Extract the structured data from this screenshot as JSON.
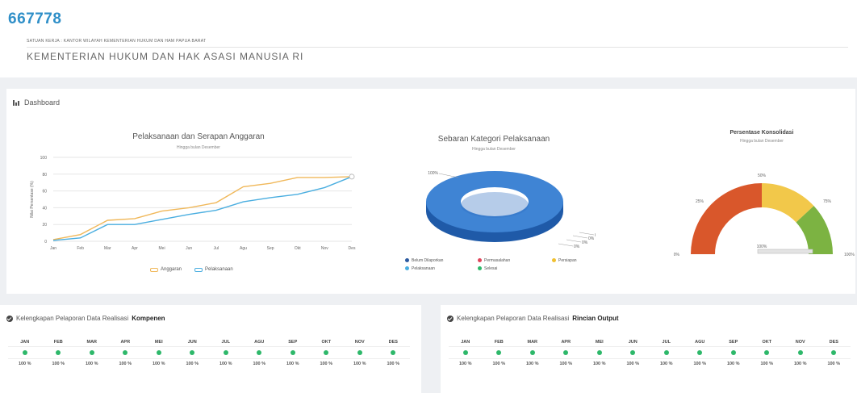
{
  "header": {
    "code": "667778",
    "unit": "SATUAN KERJA : KANTOR WILAYAH KEMENTERIAN HUKUM DAN HAM PAPUA BARAT",
    "ministry": "KEMENTERIAN HUKUM DAN HAK ASASI MANUSIA RI"
  },
  "dashboard": {
    "title": "Dashboard"
  },
  "colors": {
    "anggaran": "#f0b85a",
    "pelaksanaan": "#4aaee0",
    "pie_blue": "#3f84d4",
    "check_green": "#2eb86a"
  },
  "line_chart": {
    "title": "Pelaksanaan dan Serapan Anggaran",
    "subtitle": "Hingga bulan Desember",
    "ylabel": "Nilai Persentase (%)",
    "legend": [
      "Anggaran",
      "Pelaksanaan"
    ]
  },
  "pie_chart": {
    "title": "Sebaran Kategori Pelaksanaan",
    "subtitle": "Hingga bulan Desember",
    "labels": [
      "100%",
      "0%",
      "0%",
      "0%",
      "0%"
    ],
    "legend": [
      "Belum Dilaporkan",
      "Pelaksanaan",
      "Permasalahan",
      "Selesai",
      "Persiapan"
    ]
  },
  "gauge_chart": {
    "title": "Persentase Konsolidasi",
    "subtitle": "Hingga bulan Desember",
    "labels": [
      "0%",
      "25%",
      "50%",
      "75%",
      "100%",
      "100%"
    ]
  },
  "chart_data": [
    {
      "type": "line",
      "title": "Pelaksanaan dan Serapan Anggaran",
      "subtitle": "Hingga bulan Desember",
      "ylabel": "Nilai Persentase (%)",
      "categories": [
        "jan",
        "feb",
        "mar",
        "apr",
        "mei",
        "jun",
        "jul",
        "agu",
        "sep",
        "okt",
        "nov",
        "des"
      ],
      "ylim": [
        0,
        100
      ],
      "yticks": [
        0,
        20,
        40,
        60,
        80,
        100
      ],
      "series": [
        {
          "name": "Anggaran",
          "values": [
            2,
            8,
            25,
            27,
            36,
            40,
            46,
            65,
            69,
            76,
            76,
            77
          ]
        },
        {
          "name": "Pelaksanaan",
          "values": [
            1,
            4,
            20,
            20,
            26,
            32,
            37,
            47,
            52,
            56,
            64,
            77
          ]
        }
      ],
      "legend": "bottom"
    },
    {
      "type": "pie",
      "title": "Sebaran Kategori Pelaksanaan",
      "subtitle": "Hingga bulan Desember",
      "categories": [
        "Belum Dilaporkan",
        "Pelaksanaan",
        "Permasalahan",
        "Selesai",
        "Persiapan"
      ],
      "values": [
        100,
        0,
        0,
        0,
        0
      ],
      "legend": "bottom"
    },
    {
      "type": "gauge",
      "title": "Persentase Konsolidasi",
      "subtitle": "Hingga bulan Desember",
      "value": 100,
      "range": [
        0,
        100
      ],
      "ticks": [
        0,
        25,
        50,
        75,
        100
      ]
    }
  ],
  "kompenen": {
    "title_prefix": "Kelengkapan Pelaporan Data Realisasi",
    "title_bold": "Kompenen",
    "months": [
      "JAN",
      "FEB",
      "MAR",
      "APR",
      "MEI",
      "JUN",
      "JUL",
      "AGU",
      "SEP",
      "OKT",
      "NOV",
      "DES"
    ],
    "values": [
      "100 %",
      "100 %",
      "100 %",
      "100 %",
      "100 %",
      "100 %",
      "100 %",
      "100 %",
      "100 %",
      "100 %",
      "100 %",
      "100 %"
    ]
  },
  "rincian": {
    "title_prefix": "Kelengkapan Pelaporan Data Realisasi",
    "title_bold": "Rincian Output",
    "months": [
      "JAN",
      "FEB",
      "MAR",
      "APR",
      "MEI",
      "JUN",
      "JUL",
      "AGU",
      "SEP",
      "OKT",
      "NOV",
      "DES"
    ],
    "values": [
      "100 %",
      "100 %",
      "100 %",
      "100 %",
      "100 %",
      "100 %",
      "100 %",
      "100 %",
      "100 %",
      "100 %",
      "100 %",
      "100 %"
    ]
  }
}
